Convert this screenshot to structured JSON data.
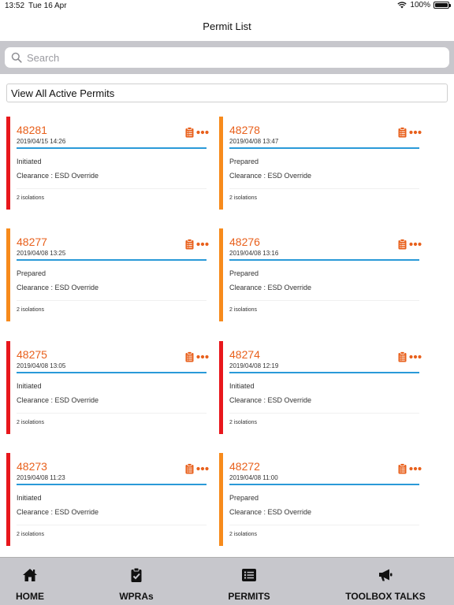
{
  "status_bar": {
    "time": "13:52",
    "date": "Tue 16 Apr",
    "battery": "100%"
  },
  "nav": {
    "title": "Permit List"
  },
  "search": {
    "placeholder": "Search",
    "value": ""
  },
  "filter": {
    "label": "View All Active Permits"
  },
  "colors": {
    "accent": "#e8601c",
    "divider": "#2a9ad8",
    "initiated": "#e8171c",
    "prepared": "#f78b1c"
  },
  "permits": [
    {
      "number": "48281",
      "date": "2019/04/15 14:26",
      "status": "Initiated",
      "clearance": "Clearance : ESD Override",
      "isolations": "2 isolations"
    },
    {
      "number": "48278",
      "date": "2019/04/08 13:47",
      "status": "Prepared",
      "clearance": "Clearance : ESD Override",
      "isolations": "2 isolations"
    },
    {
      "number": "48277",
      "date": "2019/04/08 13:25",
      "status": "Prepared",
      "clearance": "Clearance : ESD Override",
      "isolations": "2 isolations"
    },
    {
      "number": "48276",
      "date": "2019/04/08 13:16",
      "status": "Prepared",
      "clearance": "Clearance : ESD Override",
      "isolations": "2 isolations"
    },
    {
      "number": "48275",
      "date": "2019/04/08 13:05",
      "status": "Initiated",
      "clearance": "Clearance : ESD Override",
      "isolations": "2 isolations"
    },
    {
      "number": "48274",
      "date": "2019/04/08 12:19",
      "status": "Initiated",
      "clearance": "Clearance : ESD Override",
      "isolations": "2 isolations"
    },
    {
      "number": "48273",
      "date": "2019/04/08 11:23",
      "status": "Initiated",
      "clearance": "Clearance : ESD Override",
      "isolations": "2 isolations"
    },
    {
      "number": "48272",
      "date": "2019/04/08 11:00",
      "status": "Prepared",
      "clearance": "Clearance : ESD Override",
      "isolations": "2 isolations"
    }
  ],
  "tabs": [
    {
      "label": "HOME",
      "icon": "home-icon"
    },
    {
      "label": "WPRAs",
      "icon": "clipboard-check-icon"
    },
    {
      "label": "PERMITS",
      "icon": "list-icon"
    },
    {
      "label": "TOOLBOX TALKS",
      "icon": "megaphone-icon"
    }
  ]
}
